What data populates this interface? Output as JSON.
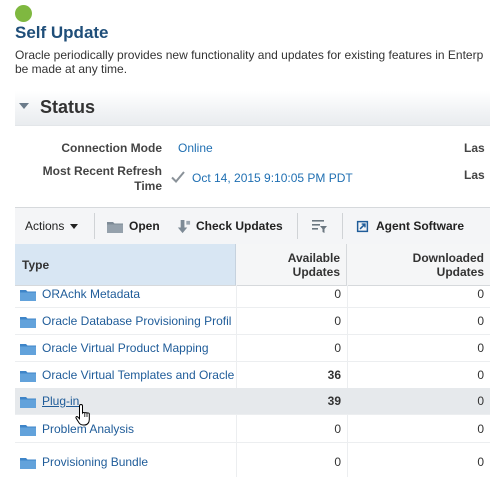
{
  "header": {
    "title": "Self Update",
    "description_line1": "Oracle periodically provides new functionality and updates for existing features in Enterp",
    "description_line2": "be made at any time.",
    "status_color": "#7fb840"
  },
  "status_section": {
    "title": "Status",
    "connection_mode_label": "Connection Mode",
    "connection_mode_value": "Online",
    "refresh_label_line1": "Most Recent Refresh",
    "refresh_label_line2": "Time",
    "refresh_value": "Oct 14, 2015 9:10:05 PM PDT",
    "right_label_1": "Las",
    "right_label_2": "Las"
  },
  "toolbar": {
    "actions_label": "Actions",
    "open_label": "Open",
    "check_updates_label": "Check Updates",
    "agent_software_label": "Agent Software"
  },
  "table": {
    "columns": {
      "type": "Type",
      "available_line1": "Available",
      "available_line2": "Updates",
      "downloaded_line1": "Downloaded",
      "downloaded_line2": "Updates"
    },
    "rows": [
      {
        "type": "ORAchk Metadata",
        "available": "0",
        "downloaded": "0"
      },
      {
        "type": "Oracle Database Provisioning Profil",
        "available": "0",
        "downloaded": "0"
      },
      {
        "type": "Oracle Virtual Product Mapping",
        "available": "0",
        "downloaded": "0"
      },
      {
        "type": "Oracle Virtual Templates and Oracle",
        "available": "36",
        "downloaded": "0"
      },
      {
        "type": "Plug-in",
        "available": "39",
        "downloaded": "0"
      },
      {
        "type": "Problem Analysis",
        "available": "0",
        "downloaded": "0"
      },
      {
        "type": "Provisioning Bundle",
        "available": "0",
        "downloaded": "0"
      }
    ]
  },
  "colors": {
    "accent": "#1f4e79",
    "link": "#1f5c99",
    "selected_header": "#d8e6f3",
    "hover_row": "#e6e9ec"
  }
}
